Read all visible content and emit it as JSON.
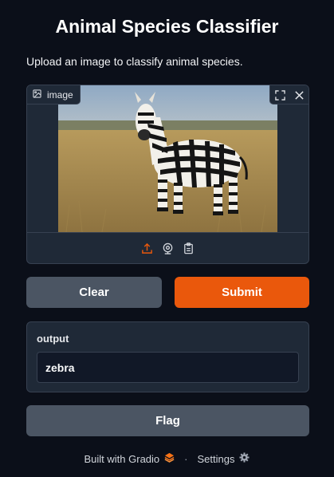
{
  "app": {
    "title": "Animal Species Classifier",
    "description": "Upload an image to classify animal species."
  },
  "image_input": {
    "label": "image",
    "icons": [
      "image-icon",
      "fullscreen-icon",
      "close-icon",
      "upload-icon",
      "webcam-icon",
      "clipboard-icon"
    ]
  },
  "buttons": {
    "clear": "Clear",
    "submit": "Submit",
    "flag": "Flag"
  },
  "output": {
    "label": "output",
    "value": "zebra"
  },
  "footer": {
    "built_with": "Built with Gradio",
    "separator": "·",
    "settings": "Settings"
  },
  "colors": {
    "background": "#0b0f19",
    "panel": "#1f2937",
    "primary": "#ea580c",
    "secondary": "#4b5563"
  }
}
